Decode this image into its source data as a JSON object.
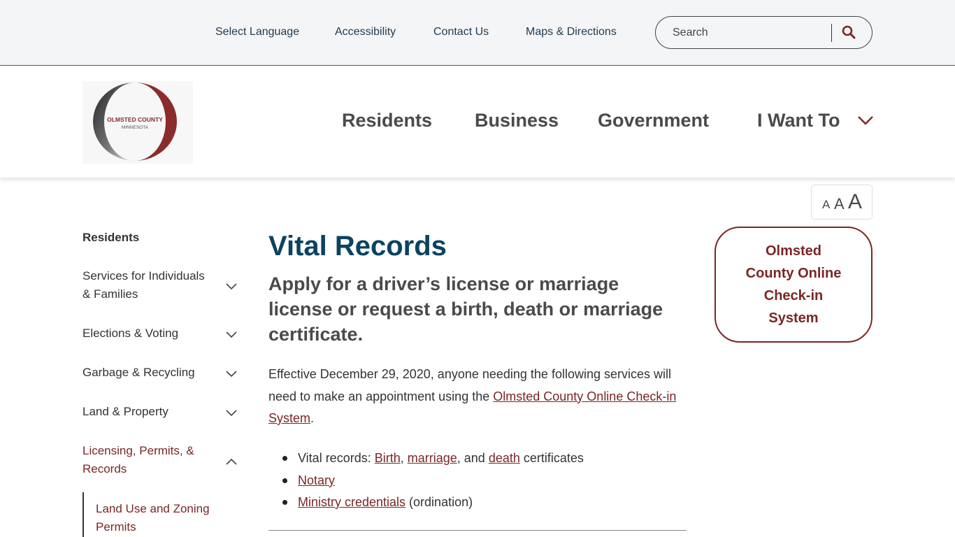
{
  "utility": {
    "links": [
      "Select Language",
      "Accessibility",
      "Contact Us",
      "Maps & Directions"
    ],
    "search_placeholder": "Search"
  },
  "logo": {
    "line1": "OLMSTED COUNTY",
    "line2": "MINNESOTA"
  },
  "main_nav": {
    "items": [
      "Residents",
      "Business",
      "Government",
      "I Want To"
    ]
  },
  "text_size": {
    "small": "A",
    "medium": "A",
    "large": "A"
  },
  "sidebar": {
    "heading": "Residents",
    "items": [
      "Services for Individuals & Families",
      "Elections & Voting",
      "Garbage & Recycling",
      "Land & Property",
      "Licensing, Permits, & Records"
    ],
    "sub_items": [
      "Land Use and Zoning Permits"
    ]
  },
  "content": {
    "title": "Vital Records",
    "subtitle": "Apply for a driver’s license or marriage license or request a birth, death or marriage certificate.",
    "intro_text": "Effective December 29, 2020, anyone needing the following services will need to make an appointment using the",
    "intro_link": "Olmsted County Online Check-in System",
    "intro_end": ".",
    "bullet1_prefix": "Vital records: ",
    "bullet1_link1": "Birth",
    "bullet1_sep1": ", ",
    "bullet1_link2": "marriage",
    "bullet1_sep2": ", and ",
    "bullet1_link3": "death",
    "bullet1_suffix": " certificates",
    "bullet2_link": "Notary",
    "bullet3_link": "Ministry credentials",
    "bullet3_suffix": " (ordination)"
  },
  "callout": {
    "label": "Olmsted County Online Check-in System"
  },
  "colors": {
    "accent": "#7a2626",
    "title": "#0b4361",
    "utility_bg": "#f4f5f7"
  }
}
